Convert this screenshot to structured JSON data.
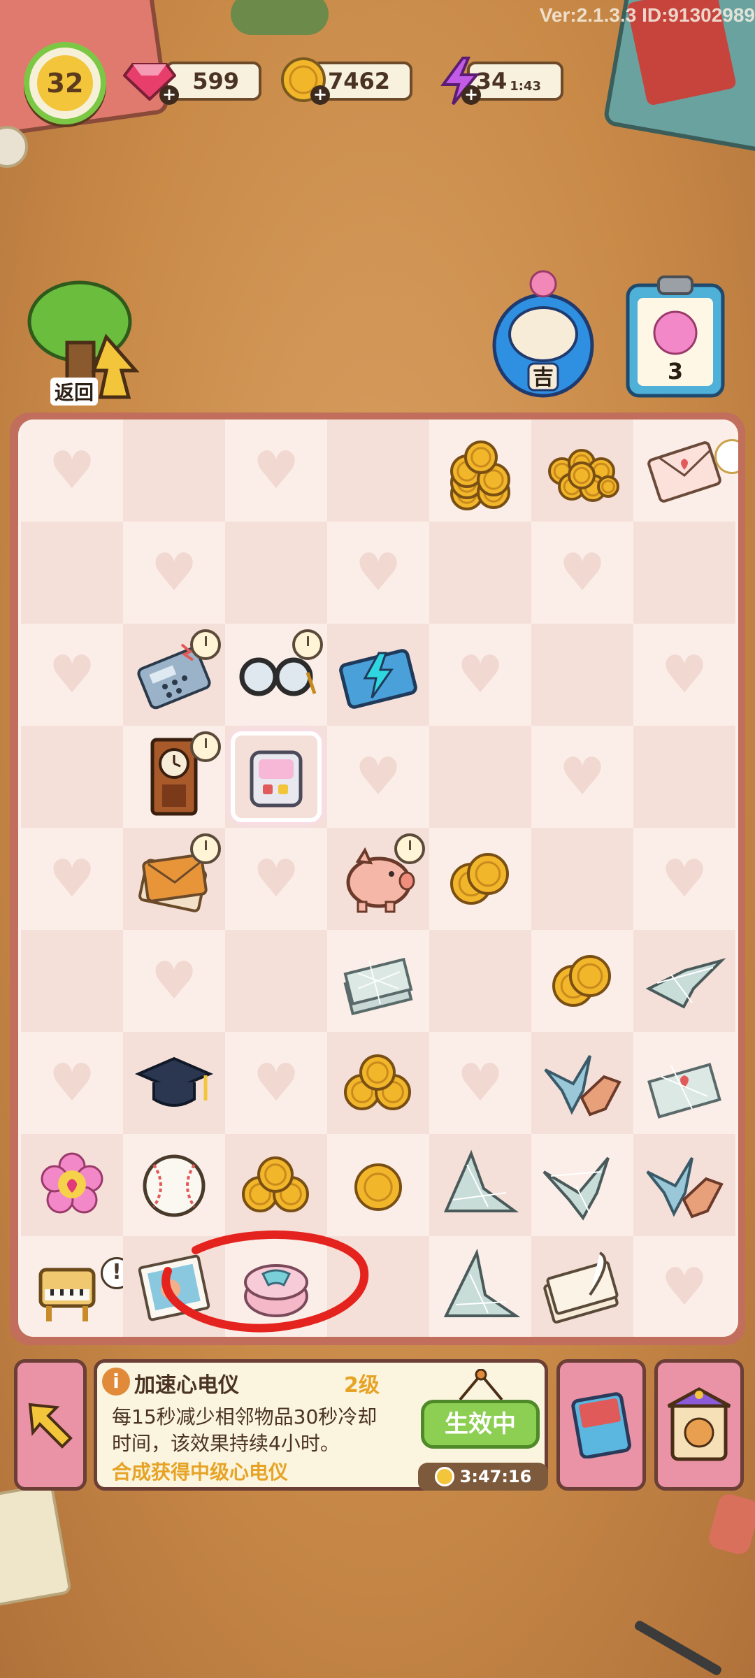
{
  "header": {
    "version": "Ver:2.1.3.3 ID:91302989",
    "level": "32",
    "gems": "599",
    "coins": "7462",
    "energy": "34",
    "energy_timer": "1:43"
  },
  "nav": {
    "back_label": "返回",
    "clipboard_count": "3",
    "daruma_char": "吉"
  },
  "board": {
    "columns": 7,
    "rows": 9,
    "items": [
      [
        "heart",
        "empty",
        "heart",
        "empty",
        "coin-stack",
        "coin-pile",
        "letter-key"
      ],
      [
        "empty",
        "heart",
        "empty",
        "heart",
        "empty",
        "heart",
        "empty"
      ],
      [
        "heart",
        "phone-cd",
        "glasses-cd",
        "book-bolt",
        "heart",
        "empty",
        "heart"
      ],
      [
        "empty",
        "clock-cd",
        "ecg-selected",
        "heart",
        "empty",
        "heart",
        "empty"
      ],
      [
        "heart",
        "envelopes-cd",
        "heart",
        "piggy-cd",
        "coins-2",
        "empty",
        "heart"
      ],
      [
        "empty",
        "heart",
        "empty",
        "paper-web",
        "empty",
        "coins-2",
        "crane-web"
      ],
      [
        "heart",
        "grad-cap",
        "heart",
        "coins-3",
        "heart",
        "crane-pair",
        "paper-web-heart"
      ],
      [
        "flower-heart",
        "baseball",
        "coins-3",
        "coin-single",
        "crane-web-2",
        "crane-web-3",
        "crane-pair"
      ],
      [
        "piano-alert",
        "photo",
        "gift-box",
        "empty",
        "crane-web-4",
        "letter-quill",
        "heart"
      ]
    ]
  },
  "info": {
    "title": "加速心电仪",
    "level": "2级",
    "description": "每15秒减少相邻物品30秒冷却时间，该效果持续4小时。",
    "hint": "合成获得中级心电仪",
    "status_button": "生效中",
    "timer": "3:47:16"
  },
  "colors": {
    "gem": "#e83e6c",
    "coin": "#f2b62a",
    "energy": "#b455e0",
    "active_green": "#8dcf52",
    "annotation_red": "#e5231e"
  }
}
